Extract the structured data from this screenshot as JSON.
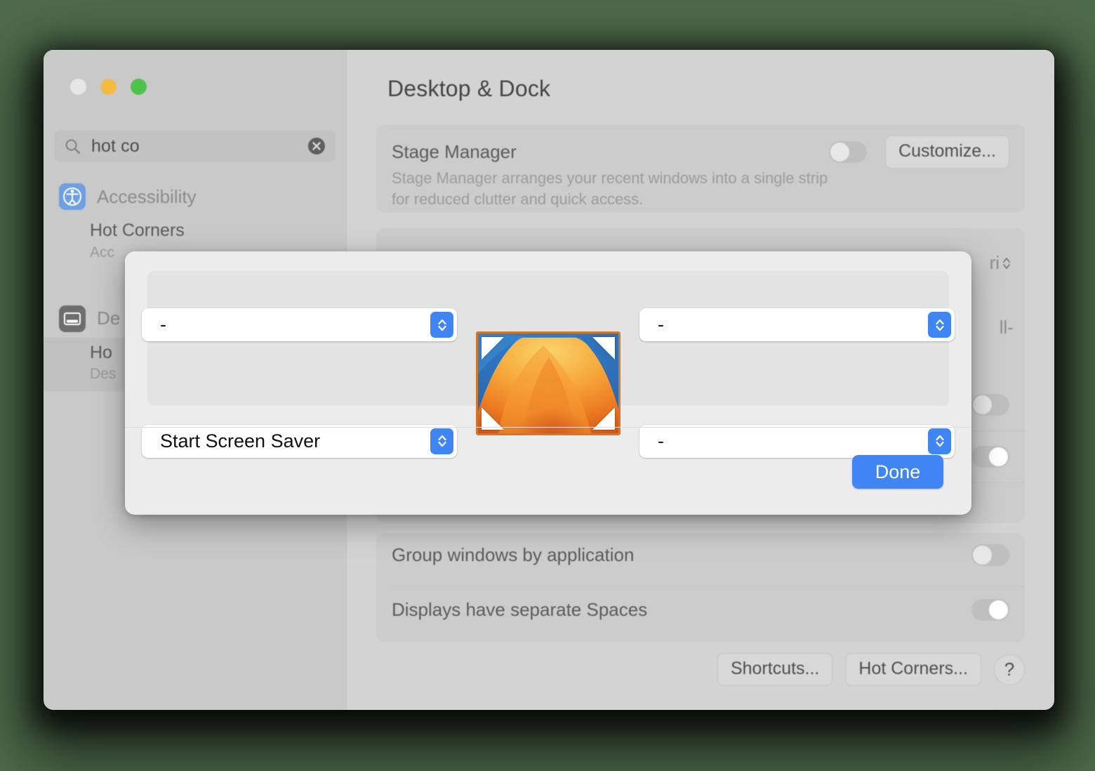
{
  "window": {
    "title": "Desktop & Dock",
    "traffic_lights": [
      "close",
      "minimize",
      "zoom"
    ]
  },
  "sidebar": {
    "search": {
      "value": "hot co",
      "placeholder": "Search",
      "icon": "search-icon",
      "clear_icon": "clear-icon"
    },
    "groups": [
      {
        "label": "Accessibility",
        "icon": "accessibility-icon",
        "results": [
          {
            "title": "Hot Corners",
            "subtitle": "Acc",
            "selected": false
          }
        ]
      },
      {
        "label": "De",
        "icon": "desktop-dock-icon",
        "results": [
          {
            "title": "Ho",
            "subtitle": "Des",
            "selected": true
          }
        ]
      }
    ]
  },
  "detail": {
    "stage_manager": {
      "label": "Stage Manager",
      "description": "Stage Manager arranges your recent windows into a single strip for reduced clutter and quick access.",
      "toggle_on": false,
      "customize_label": "Customize..."
    },
    "occluded": {
      "siri_fragment": "ri",
      "hyphen_fragment": "ll-"
    },
    "rows": [
      {
        "label": "",
        "toggle_on": false
      },
      {
        "label": "",
        "toggle_on": true
      },
      {
        "label": "Group windows by application",
        "toggle_on": false
      },
      {
        "label": "Displays have separate Spaces",
        "toggle_on": true
      }
    ],
    "buttons": {
      "shortcuts": "Shortcuts...",
      "hot_corners": "Hot Corners...",
      "help": "?"
    }
  },
  "sheet": {
    "corners": [
      {
        "position": "top-left",
        "value": "-"
      },
      {
        "position": "top-right",
        "value": "-"
      },
      {
        "position": "bottom-left",
        "value": "Start Screen Saver"
      },
      {
        "position": "bottom-right",
        "value": "-"
      }
    ],
    "preview_alt": "desktop-wallpaper-preview",
    "done_label": "Done"
  },
  "colors": {
    "accent_blue": "#3f86f4",
    "desktop_green": "#4e6b4b",
    "window_gray": "#d3d3d3",
    "sheet_gray": "#ececec"
  }
}
